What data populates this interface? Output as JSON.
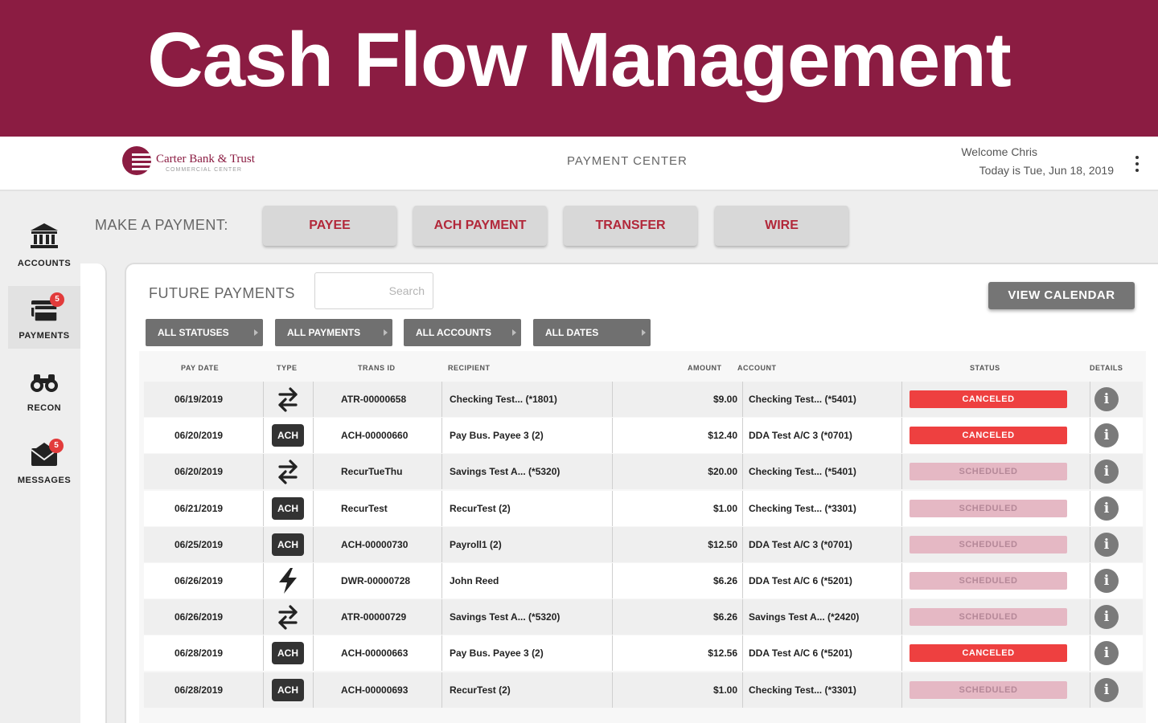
{
  "banner": {
    "title": "Cash Flow Management"
  },
  "header": {
    "bank_name": "Carter Bank & Trust",
    "bank_subtitle": "COMMERCIAL CENTER",
    "center_title": "PAYMENT CENTER",
    "welcome": "Welcome Chris",
    "today": "Today is Tue, Jun 18, 2019"
  },
  "colors": {
    "brand": "#8b1c42",
    "canceled": "#ee4040",
    "scheduled": "#e5b8c4",
    "button_text": "#b2283a"
  },
  "sidebar": {
    "items": [
      {
        "label": "ACCOUNTS",
        "icon": "bank-icon",
        "badge": ""
      },
      {
        "label": "PAYMENTS",
        "icon": "payments-card-icon",
        "badge": "5"
      },
      {
        "label": "RECON",
        "icon": "binoculars-icon",
        "badge": ""
      },
      {
        "label": "MESSAGES",
        "icon": "envelope-icon",
        "badge": "5"
      }
    ]
  },
  "make_payment": {
    "label": "MAKE A PAYMENT:",
    "buttons": [
      "PAYEE",
      "ACH PAYMENT",
      "TRANSFER",
      "WIRE"
    ]
  },
  "future_payments": {
    "title": "FUTURE PAYMENTS",
    "search_placeholder": "Search",
    "view_calendar": "VIEW CALENDAR",
    "filters": [
      "ALL STATUSES",
      "ALL PAYMENTS",
      "ALL ACCOUNTS",
      "ALL DATES"
    ]
  },
  "table": {
    "columns": [
      "PAY DATE",
      "TYPE",
      "TRANS ID",
      "RECIPIENT",
      "AMOUNT",
      "ACCOUNT",
      "STATUS",
      "DETAILS"
    ],
    "rows": [
      {
        "pay_date": "06/19/2019",
        "type": "transfer",
        "trans_id": "ATR-00000658",
        "recipient": "Checking Test... (*1801)",
        "amount": "$9.00",
        "account": "Checking Test... (*5401)",
        "status": "CANCELED"
      },
      {
        "pay_date": "06/20/2019",
        "type": "ACH",
        "trans_id": "ACH-00000660",
        "recipient": "Pay Bus. Payee 3 (2)",
        "amount": "$12.40",
        "account": "DDA Test A/C 3 (*0701)",
        "status": "CANCELED"
      },
      {
        "pay_date": "06/20/2019",
        "type": "transfer",
        "trans_id": "RecurTueThu",
        "recipient": "Savings Test A... (*5320)",
        "amount": "$20.00",
        "account": "Checking Test... (*5401)",
        "status": "SCHEDULED"
      },
      {
        "pay_date": "06/21/2019",
        "type": "ACH",
        "trans_id": "RecurTest",
        "recipient": "RecurTest (2)",
        "amount": "$1.00",
        "account": "Checking Test... (*3301)",
        "status": "SCHEDULED"
      },
      {
        "pay_date": "06/25/2019",
        "type": "ACH",
        "trans_id": "ACH-00000730",
        "recipient": "Payroll1 (2)",
        "amount": "$12.50",
        "account": "DDA Test A/C 3 (*0701)",
        "status": "SCHEDULED"
      },
      {
        "pay_date": "06/26/2019",
        "type": "wire",
        "trans_id": "DWR-00000728",
        "recipient": "John Reed",
        "amount": "$6.26",
        "account": "DDA Test A/C 6 (*5201)",
        "status": "SCHEDULED"
      },
      {
        "pay_date": "06/26/2019",
        "type": "transfer",
        "trans_id": "ATR-00000729",
        "recipient": "Savings Test A... (*5320)",
        "amount": "$6.26",
        "account": "Savings Test A... (*2420)",
        "status": "SCHEDULED"
      },
      {
        "pay_date": "06/28/2019",
        "type": "ACH",
        "trans_id": "ACH-00000663",
        "recipient": "Pay Bus. Payee 3 (2)",
        "amount": "$12.56",
        "account": "DDA Test A/C 6 (*5201)",
        "status": "CANCELED"
      },
      {
        "pay_date": "06/28/2019",
        "type": "ACH",
        "trans_id": "ACH-00000693",
        "recipient": "RecurTest (2)",
        "amount": "$1.00",
        "account": "Checking Test... (*3301)",
        "status": "SCHEDULED"
      }
    ]
  }
}
